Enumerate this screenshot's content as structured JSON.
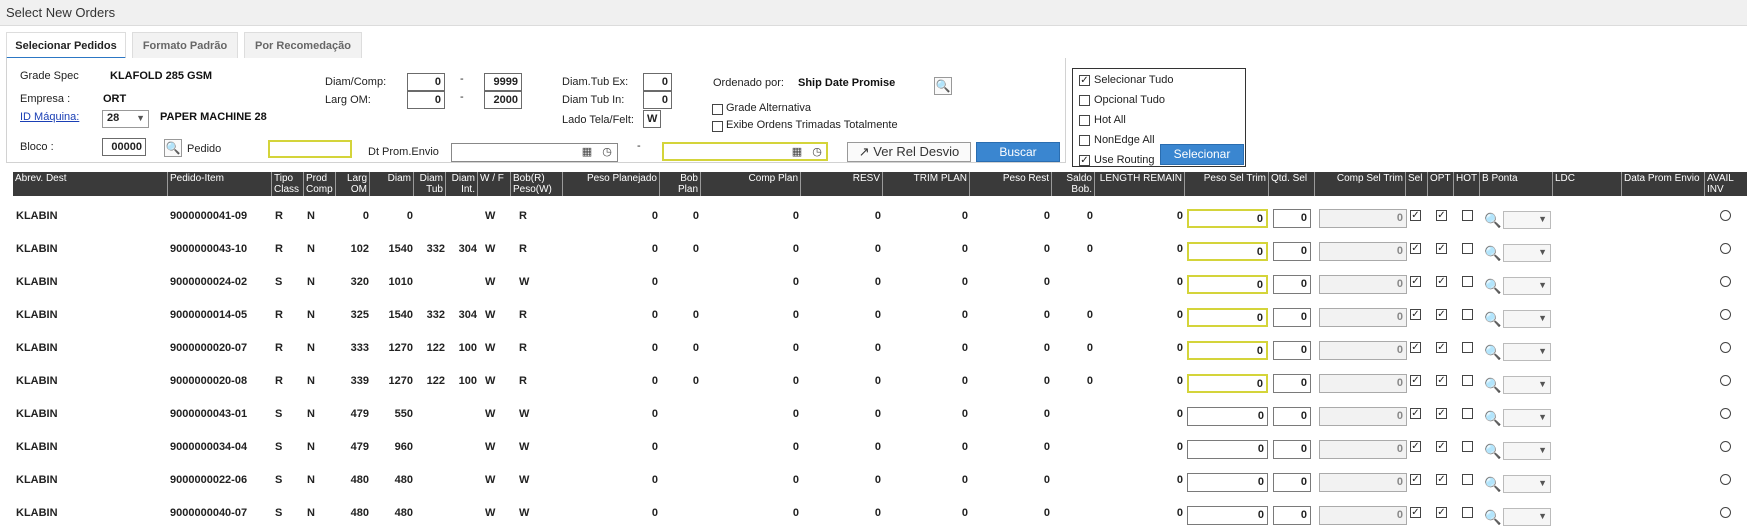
{
  "window_title": "Select New Orders",
  "tabs": [
    {
      "label": "Selecionar Pedidos"
    },
    {
      "label": "Formato Padrão"
    },
    {
      "label": "Por Recomedação"
    }
  ],
  "filters": {
    "grade_spec_label": "Grade Spec",
    "grade_spec_value": "KLAFOLD 285 GSM",
    "empresa_label": "Empresa :",
    "empresa_value": "ORT",
    "id_maquina_label": "ID Máquina:",
    "id_maquina_value": "28",
    "machine_name": "PAPER MACHINE 28",
    "bloco_label": "Bloco :",
    "bloco_value": "00000",
    "pedido_label": "Pedido",
    "pedido_value": "",
    "diam_comp_label": "Diam/Comp:",
    "diam_comp_from": "0",
    "diam_comp_to": "9999",
    "larg_om_label": "Larg OM:",
    "larg_om_from": "0",
    "larg_om_to": "2000",
    "range_sep": "-",
    "diam_tub_ex_label": "Diam.Tub Ex:",
    "diam_tub_ex_value": "0",
    "diam_tub_in_label": "Diam Tub In:",
    "diam_tub_in_value": "0",
    "lado_label": "Lado Tela/Felt:",
    "lado_value": "W",
    "ordenado_label": "Ordenado por:",
    "ordenado_value": "Ship Date Promise",
    "grade_alternativa_label": "Grade Alternativa",
    "exibe_ordens_label": "Exibe Ordens Trimadas Totalmente",
    "dt_prom_label": "Dt Prom.Envio",
    "dt_from": "",
    "dt_to": "",
    "ver_rel_label": "Ver Rel Desvio",
    "buscar_label": "Buscar"
  },
  "checkpanel": {
    "items": [
      {
        "label": "Selecionar Tudo",
        "checked": true
      },
      {
        "label": "Opcional Tudo",
        "checked": false
      },
      {
        "label": "Hot All",
        "checked": false
      },
      {
        "label": "NonEdge All",
        "checked": false
      },
      {
        "label": "Use Routing",
        "checked": true
      }
    ],
    "selecionar_label": "Selecionar"
  },
  "grid": {
    "columns": [
      "Abrev. Dest",
      "Pedido-Item",
      "Tipo Class",
      "Prod Comp",
      "Larg OM",
      "Diam",
      "Diam Tub",
      "Diam Int.",
      "W / F",
      "Bob(R) Peso(W)",
      "Peso Planejado",
      "Bob Plan",
      "Comp Plan",
      "RESV",
      "TRIM PLAN",
      "Peso Rest",
      "Saldo Bob.",
      "LENGTH REMAIN",
      "Peso Sel Trim",
      "Qtd. Sel",
      "Comp Sel Trim",
      "Sel",
      "OPT",
      "HOT",
      "B Ponta",
      "LDC",
      "Data Prom Envio",
      "AVAIL INV"
    ],
    "rows": [
      {
        "dest": "KLABIN",
        "pedido": "9000000041-09",
        "tipo": "R",
        "prod": "N",
        "larg": "0",
        "diam": "0",
        "dtub": "",
        "dint": "",
        "wf": "W",
        "bob": "R",
        "peso_plan": "0",
        "bob_plan": "0",
        "comp_plan": "0",
        "resv": "0",
        "trim": "0",
        "peso_rest": "0",
        "saldo": "0",
        "length": "0",
        "peso_sel": "0",
        "qtd": "0",
        "comp_sel": "0",
        "qtd_yellow": true
      },
      {
        "dest": "KLABIN",
        "pedido": "9000000043-10",
        "tipo": "R",
        "prod": "N",
        "larg": "102",
        "diam": "1540",
        "dtub": "332",
        "dint": "304",
        "wf": "W",
        "bob": "R",
        "peso_plan": "0",
        "bob_plan": "0",
        "comp_plan": "0",
        "resv": "0",
        "trim": "0",
        "peso_rest": "0",
        "saldo": "0",
        "length": "0",
        "peso_sel": "0",
        "qtd": "0",
        "comp_sel": "0",
        "qtd_yellow": true
      },
      {
        "dest": "KLABIN",
        "pedido": "9000000024-02",
        "tipo": "S",
        "prod": "N",
        "larg": "320",
        "diam": "1010",
        "dtub": "",
        "dint": "",
        "wf": "W",
        "bob": "W",
        "peso_plan": "0",
        "bob_plan": "",
        "comp_plan": "0",
        "resv": "0",
        "trim": "0",
        "peso_rest": "0",
        "saldo": "",
        "length": "0",
        "peso_sel": "0",
        "qtd": "0",
        "comp_sel": "0",
        "qtd_yellow": true
      },
      {
        "dest": "KLABIN",
        "pedido": "9000000014-05",
        "tipo": "R",
        "prod": "N",
        "larg": "325",
        "diam": "1540",
        "dtub": "332",
        "dint": "304",
        "wf": "W",
        "bob": "R",
        "peso_plan": "0",
        "bob_plan": "0",
        "comp_plan": "0",
        "resv": "0",
        "trim": "0",
        "peso_rest": "0",
        "saldo": "0",
        "length": "0",
        "peso_sel": "0",
        "qtd": "0",
        "comp_sel": "0",
        "qtd_yellow": true
      },
      {
        "dest": "KLABIN",
        "pedido": "9000000020-07",
        "tipo": "R",
        "prod": "N",
        "larg": "333",
        "diam": "1270",
        "dtub": "122",
        "dint": "100",
        "wf": "W",
        "bob": "R",
        "peso_plan": "0",
        "bob_plan": "0",
        "comp_plan": "0",
        "resv": "0",
        "trim": "0",
        "peso_rest": "0",
        "saldo": "0",
        "length": "0",
        "peso_sel": "0",
        "qtd": "0",
        "comp_sel": "0",
        "qtd_yellow": true
      },
      {
        "dest": "KLABIN",
        "pedido": "9000000020-08",
        "tipo": "R",
        "prod": "N",
        "larg": "339",
        "diam": "1270",
        "dtub": "122",
        "dint": "100",
        "wf": "W",
        "bob": "R",
        "peso_plan": "0",
        "bob_plan": "0",
        "comp_plan": "0",
        "resv": "0",
        "trim": "0",
        "peso_rest": "0",
        "saldo": "0",
        "length": "0",
        "peso_sel": "0",
        "qtd": "0",
        "comp_sel": "0",
        "qtd_yellow": true
      },
      {
        "dest": "KLABIN",
        "pedido": "9000000043-01",
        "tipo": "S",
        "prod": "N",
        "larg": "479",
        "diam": "550",
        "dtub": "",
        "dint": "",
        "wf": "W",
        "bob": "W",
        "peso_plan": "0",
        "bob_plan": "",
        "comp_plan": "0",
        "resv": "0",
        "trim": "0",
        "peso_rest": "0",
        "saldo": "",
        "length": "0",
        "peso_sel": "0",
        "qtd": "0",
        "comp_sel": "0",
        "qtd_yellow": false
      },
      {
        "dest": "KLABIN",
        "pedido": "9000000034-04",
        "tipo": "S",
        "prod": "N",
        "larg": "479",
        "diam": "960",
        "dtub": "",
        "dint": "",
        "wf": "W",
        "bob": "W",
        "peso_plan": "0",
        "bob_plan": "",
        "comp_plan": "0",
        "resv": "0",
        "trim": "0",
        "peso_rest": "0",
        "saldo": "",
        "length": "0",
        "peso_sel": "0",
        "qtd": "0",
        "comp_sel": "0",
        "qtd_yellow": false
      },
      {
        "dest": "KLABIN",
        "pedido": "9000000022-06",
        "tipo": "S",
        "prod": "N",
        "larg": "480",
        "diam": "480",
        "dtub": "",
        "dint": "",
        "wf": "W",
        "bob": "W",
        "peso_plan": "0",
        "bob_plan": "",
        "comp_plan": "0",
        "resv": "0",
        "trim": "0",
        "peso_rest": "0",
        "saldo": "",
        "length": "0",
        "peso_sel": "0",
        "qtd": "0",
        "comp_sel": "0",
        "qtd_yellow": false
      },
      {
        "dest": "KLABIN",
        "pedido": "9000000040-07",
        "tipo": "S",
        "prod": "N",
        "larg": "480",
        "diam": "480",
        "dtub": "",
        "dint": "",
        "wf": "W",
        "bob": "W",
        "peso_plan": "0",
        "bob_plan": "",
        "comp_plan": "0",
        "resv": "0",
        "trim": "0",
        "peso_rest": "0",
        "saldo": "",
        "length": "0",
        "peso_sel": "0",
        "qtd": "0",
        "comp_sel": "0",
        "qtd_yellow": false
      }
    ]
  },
  "icons": {
    "calendar": "calendar-icon",
    "clock": "clock-icon",
    "search": "search-icon",
    "external": "external-link-icon"
  },
  "colors": {
    "accent": "#3a86d0",
    "highlight": "#d4d43a",
    "header_bg": "#3a3a3a"
  }
}
